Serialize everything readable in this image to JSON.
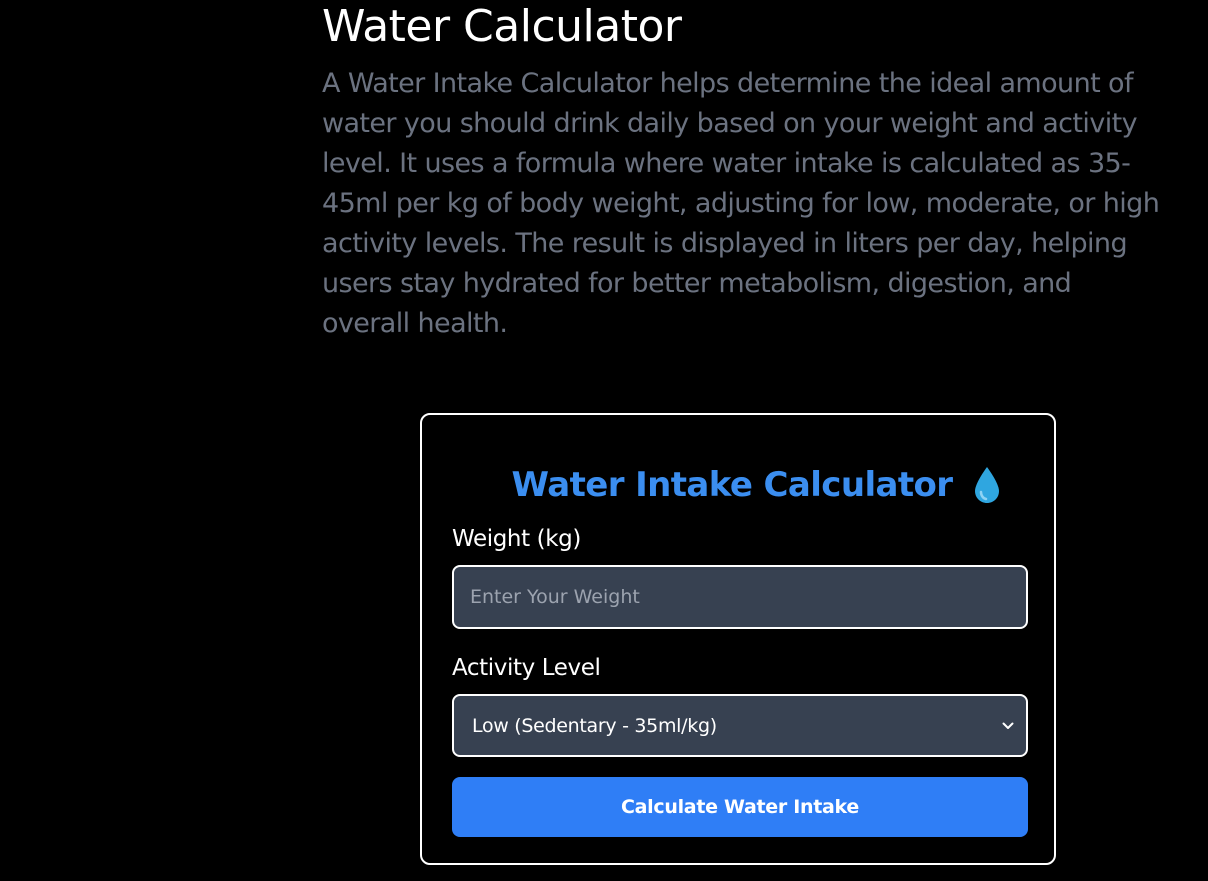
{
  "header": {
    "title": "Water Calculator",
    "description": "A Water Intake Calculator helps determine the ideal amount of water you should drink daily based on your weight and activity level. It uses a formula where water intake is calculated as 35-45ml per kg of body weight, adjusting for low, moderate, or high activity levels. The result is displayed in liters per day, helping users stay hydrated for better metabolism, digestion, and overall health."
  },
  "calculator": {
    "title": "Water Intake Calculator",
    "title_icon": "water-drop-icon",
    "weight_label": "Weight (kg)",
    "weight_value": "",
    "weight_placeholder": "Enter Your Weight",
    "activity_label": "Activity Level",
    "activity_selected": "Low (Sedentary - 35ml/kg)",
    "button_label": "Calculate Water Intake"
  },
  "colors": {
    "background": "#000000",
    "title_accent": "#3b8ef0",
    "button": "#2f7ef6",
    "input_bg": "#374151",
    "description_text": "#6b7280"
  }
}
